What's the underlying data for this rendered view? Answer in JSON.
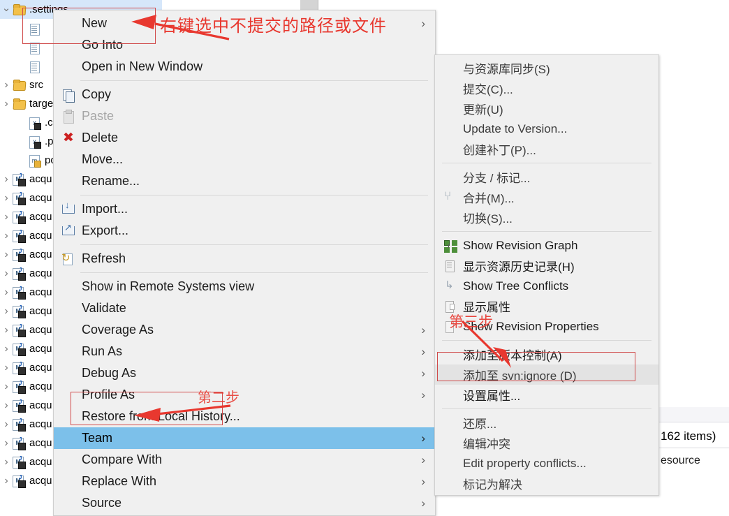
{
  "tree": {
    "rows": [
      {
        "indent": 0,
        "twisty": "open",
        "icon": "folder",
        "label": ".settings",
        "selected": true
      },
      {
        "indent": 1,
        "twisty": "none",
        "icon": "file",
        "label": "",
        "selected": false
      },
      {
        "indent": 1,
        "twisty": "none",
        "icon": "file",
        "label": "",
        "selected": false
      },
      {
        "indent": 1,
        "twisty": "none",
        "icon": "file",
        "label": "",
        "selected": false
      },
      {
        "indent": 0,
        "twisty": "closed",
        "icon": "folder",
        "label": "src",
        "selected": false
      },
      {
        "indent": 0,
        "twisty": "closed",
        "icon": "folder",
        "label": "target",
        "selected": false
      },
      {
        "indent": 1,
        "twisty": "none",
        "icon": "xml",
        "label": ".classpath",
        "selected": false
      },
      {
        "indent": 1,
        "twisty": "none",
        "icon": "xml",
        "label": ".project",
        "selected": false
      },
      {
        "indent": 1,
        "twisty": "none",
        "icon": "pom",
        "label": "pom.xml",
        "selected": false
      },
      {
        "indent": 0,
        "twisty": "closed",
        "icon": "maven",
        "label": "acqu",
        "selected": false
      },
      {
        "indent": 0,
        "twisty": "closed",
        "icon": "maven",
        "label": "acqu",
        "selected": false
      },
      {
        "indent": 0,
        "twisty": "closed",
        "icon": "maven",
        "label": "acqu",
        "selected": false
      },
      {
        "indent": 0,
        "twisty": "closed",
        "icon": "maven",
        "label": "acqu",
        "selected": false
      },
      {
        "indent": 0,
        "twisty": "closed",
        "icon": "maven",
        "label": "acqu",
        "selected": false
      },
      {
        "indent": 0,
        "twisty": "closed",
        "icon": "maven",
        "label": "acqu",
        "selected": false
      },
      {
        "indent": 0,
        "twisty": "closed",
        "icon": "maven",
        "label": "acqu",
        "selected": false
      },
      {
        "indent": 0,
        "twisty": "closed",
        "icon": "maven",
        "label": "acqu",
        "selected": false
      },
      {
        "indent": 0,
        "twisty": "closed",
        "icon": "maven",
        "label": "acqu",
        "selected": false
      },
      {
        "indent": 0,
        "twisty": "closed",
        "icon": "maven",
        "label": "acqu",
        "selected": false
      },
      {
        "indent": 0,
        "twisty": "closed",
        "icon": "maven",
        "label": "acqu",
        "selected": false
      },
      {
        "indent": 0,
        "twisty": "closed",
        "icon": "maven",
        "label": "acqu",
        "selected": false
      },
      {
        "indent": 0,
        "twisty": "closed",
        "icon": "maven",
        "label": "acqu",
        "selected": false
      },
      {
        "indent": 0,
        "twisty": "closed",
        "icon": "maven",
        "label": "acqu",
        "selected": false
      },
      {
        "indent": 0,
        "twisty": "closed",
        "icon": "maven",
        "label": "acqu",
        "selected": false
      },
      {
        "indent": 0,
        "twisty": "closed",
        "icon": "maven",
        "label": "acqu",
        "selected": false
      },
      {
        "indent": 0,
        "twisty": "closed",
        "icon": "maven",
        "label": "acqu",
        "selected": false
      }
    ]
  },
  "context_menu": {
    "items": [
      {
        "label": "New",
        "icon": "none",
        "arrow": true,
        "dim": false,
        "sep_after": false,
        "highlight": false
      },
      {
        "label": "Go Into",
        "icon": "none",
        "arrow": false,
        "dim": false,
        "sep_after": false,
        "highlight": false
      },
      {
        "label": "Open in New Window",
        "icon": "none",
        "arrow": false,
        "dim": false,
        "sep_after": true,
        "highlight": false
      },
      {
        "label": "Copy",
        "icon": "copy-icon",
        "arrow": false,
        "dim": false,
        "sep_after": false,
        "highlight": false
      },
      {
        "label": "Paste",
        "icon": "paste-icon",
        "arrow": false,
        "dim": true,
        "sep_after": false,
        "highlight": false
      },
      {
        "label": "Delete",
        "icon": "delete-icon",
        "arrow": false,
        "dim": false,
        "sep_after": false,
        "highlight": false
      },
      {
        "label": "Move...",
        "icon": "none",
        "arrow": false,
        "dim": false,
        "sep_after": false,
        "highlight": false
      },
      {
        "label": "Rename...",
        "icon": "none",
        "arrow": false,
        "dim": false,
        "sep_after": true,
        "highlight": false
      },
      {
        "label": "Import...",
        "icon": "import-icon",
        "arrow": false,
        "dim": false,
        "sep_after": false,
        "highlight": false
      },
      {
        "label": "Export...",
        "icon": "export-icon",
        "arrow": false,
        "dim": false,
        "sep_after": true,
        "highlight": false
      },
      {
        "label": "Refresh",
        "icon": "refresh-icon",
        "arrow": false,
        "dim": false,
        "sep_after": true,
        "highlight": false
      },
      {
        "label": "Show in Remote Systems view",
        "icon": "none",
        "arrow": false,
        "dim": false,
        "sep_after": false,
        "highlight": false
      },
      {
        "label": "Validate",
        "icon": "none",
        "arrow": false,
        "dim": false,
        "sep_after": false,
        "highlight": false
      },
      {
        "label": "Coverage As",
        "icon": "none",
        "arrow": true,
        "dim": false,
        "sep_after": false,
        "highlight": false
      },
      {
        "label": "Run As",
        "icon": "none",
        "arrow": true,
        "dim": false,
        "sep_after": false,
        "highlight": false
      },
      {
        "label": "Debug As",
        "icon": "none",
        "arrow": true,
        "dim": false,
        "sep_after": false,
        "highlight": false
      },
      {
        "label": "Profile As",
        "icon": "none",
        "arrow": true,
        "dim": false,
        "sep_after": false,
        "highlight": false
      },
      {
        "label": "Restore from Local History...",
        "icon": "none",
        "arrow": false,
        "dim": false,
        "sep_after": false,
        "highlight": false
      },
      {
        "label": "Team",
        "icon": "none",
        "arrow": true,
        "dim": false,
        "sep_after": false,
        "highlight": true
      },
      {
        "label": "Compare With",
        "icon": "none",
        "arrow": true,
        "dim": false,
        "sep_after": false,
        "highlight": false
      },
      {
        "label": "Replace With",
        "icon": "none",
        "arrow": true,
        "dim": false,
        "sep_after": false,
        "highlight": false
      },
      {
        "label": "Source",
        "icon": "none",
        "arrow": true,
        "dim": false,
        "sep_after": false,
        "highlight": false
      }
    ]
  },
  "svn_submenu": {
    "items": [
      {
        "label": "与资源库同步(S)",
        "icon": "none",
        "sep_after": false,
        "hover": false,
        "dark": false
      },
      {
        "label": "提交(C)...",
        "icon": "none",
        "sep_after": false,
        "hover": false,
        "dark": false
      },
      {
        "label": "更新(U)",
        "icon": "none",
        "sep_after": false,
        "hover": false,
        "dark": false
      },
      {
        "label": "Update to Version...",
        "icon": "none",
        "sep_after": false,
        "hover": false,
        "dark": false
      },
      {
        "label": "创建补丁(P)...",
        "icon": "none",
        "sep_after": true,
        "hover": false,
        "dark": false
      },
      {
        "label": "分支 / 标记...",
        "icon": "none",
        "sep_after": false,
        "hover": false,
        "dark": false
      },
      {
        "label": "合并(M)...",
        "icon": "merge-icon",
        "sep_after": false,
        "hover": false,
        "dark": false
      },
      {
        "label": "切换(S)...",
        "icon": "none",
        "sep_after": true,
        "hover": false,
        "dark": false
      },
      {
        "label": "Show Revision Graph",
        "icon": "revision-graph-icon",
        "sep_after": false,
        "hover": false,
        "dark": true
      },
      {
        "label": "显示资源历史记录(H)",
        "icon": "history-icon",
        "sep_after": false,
        "hover": false,
        "dark": true
      },
      {
        "label": "Show Tree Conflicts",
        "icon": "tree-conflicts-icon",
        "sep_after": false,
        "hover": false,
        "dark": true
      },
      {
        "label": "显示属性",
        "icon": "properties-icon",
        "sep_after": false,
        "hover": false,
        "dark": true
      },
      {
        "label": "Show Revision Properties",
        "icon": "show-revision-properties-icon",
        "sep_after": true,
        "hover": false,
        "dark": true
      },
      {
        "label": "添加至版本控制(A)",
        "icon": "none",
        "sep_after": false,
        "hover": false,
        "dark": true
      },
      {
        "label": "添加至 svn:ignore (D)",
        "icon": "none",
        "sep_after": false,
        "hover": true,
        "dark": false
      },
      {
        "label": "设置属性...",
        "icon": "none",
        "sep_after": true,
        "hover": false,
        "dark": true
      },
      {
        "label": "还原...",
        "icon": "none",
        "sep_after": false,
        "hover": false,
        "dark": false
      },
      {
        "label": "编辑冲突",
        "icon": "none",
        "sep_after": false,
        "hover": false,
        "dark": false
      },
      {
        "label": "Edit property conflicts...",
        "icon": "none",
        "sep_after": false,
        "hover": false,
        "dark": false
      },
      {
        "label": "标记为解决",
        "icon": "none",
        "sep_after": false,
        "hover": false,
        "dark": false
      }
    ]
  },
  "annotations": {
    "step1_text": "右键选中不提交的路径或文件",
    "step2_text": "第二步",
    "step3_text": "第三步",
    "accent_color": "#e8382f",
    "box_color": "#d04a4a"
  },
  "background_panel": {
    "items_count": "162 items)",
    "resource_text": "esource"
  }
}
